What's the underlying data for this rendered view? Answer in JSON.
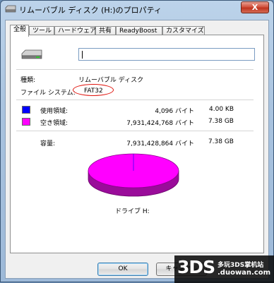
{
  "window": {
    "title": "リムーバブル ディスク (H:)のプロパティ",
    "close_label": "X"
  },
  "tabs": [
    {
      "label": "全般",
      "active": true
    },
    {
      "label": "ツール"
    },
    {
      "label": "ハードウェア"
    },
    {
      "label": "共有"
    },
    {
      "label": "ReadyBoost"
    },
    {
      "label": "カスタマイズ"
    }
  ],
  "general": {
    "name_value": "",
    "type_label": "種類:",
    "type_value": "リムーバブル ディスク",
    "fs_label": "ファイル システム:",
    "fs_value": "FAT32",
    "used": {
      "label": "使用領域:",
      "bytes": "4,096 バイト",
      "size": "4.00 KB",
      "color": "#0000ff"
    },
    "free": {
      "label": "空き領域:",
      "bytes": "7,931,424,768 バイト",
      "size": "7.38 GB",
      "color": "#ff00ff"
    },
    "capacity": {
      "label": "容量:",
      "bytes": "7,931,428,864 バイト",
      "size": "7.38 GB"
    },
    "drive_label": "ドライブ H:",
    "used_fraction": 5e-07
  },
  "buttons": {
    "ok": "OK",
    "cancel": "キャンセル"
  },
  "watermark": {
    "big": "3DS",
    "cn": "多玩3DS掌机站",
    "url": ".duowan.com"
  }
}
